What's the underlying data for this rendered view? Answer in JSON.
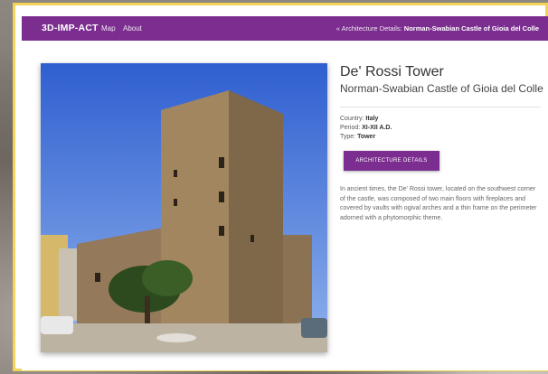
{
  "navbar": {
    "brand": "3D-IMP-ACT",
    "links": [
      "Map",
      "About"
    ],
    "breadcrumb_prefix": "« Architecture Details:",
    "breadcrumb_current": "Norman-Swabian Castle of Gioia del Colle"
  },
  "detail": {
    "title": "De' Rossi Tower",
    "subtitle": "Norman-Swabian Castle of Gioia del Colle",
    "country_label": "Country:",
    "country": "Italy",
    "period_label": "Period:",
    "period": "XI-XII A.D.",
    "type_label": "Type:",
    "type": "Tower",
    "button_label": "ARCHITECTURE DETAILS",
    "description": "In ancient times, the De' Rossi tower, located on the southwest corner of the castle, was composed of two main floors with fireplaces and covered by vaults with ogival arches and a thin frame on the perimeter adorned with a phytomorphic theme."
  },
  "colors": {
    "accent": "#7b2e8f",
    "frame": "#f3d45a"
  }
}
